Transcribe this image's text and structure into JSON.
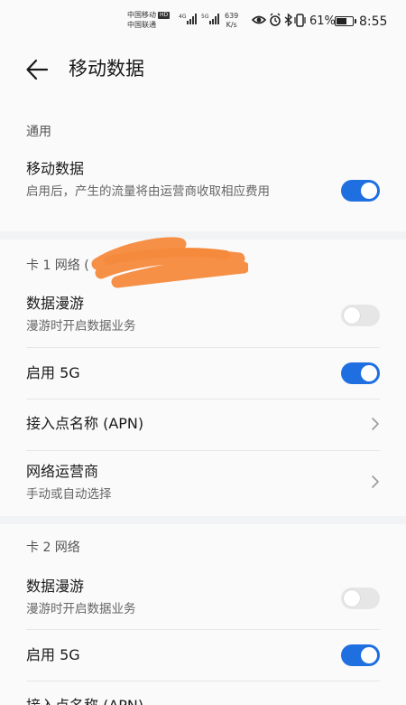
{
  "status_bar": {
    "carrier1": "中国移动",
    "hd": "HD",
    "carrier2": "中国联通",
    "net1": "4G",
    "net2": "5G",
    "speed_value": "639",
    "speed_unit": "K/s",
    "battery": "61%",
    "time": "8:55"
  },
  "header": {
    "title": "移动数据"
  },
  "general": {
    "heading": "通用",
    "mobile_data": {
      "title": "移动数据",
      "subtitle": "启用后，产生的流量将由运营商收取相应费用",
      "enabled": true
    }
  },
  "sim1": {
    "heading": "卡 1 网络 (",
    "roaming": {
      "title": "数据漫游",
      "subtitle": "漫游时开启数据业务",
      "enabled": false
    },
    "enable_5g": {
      "title": "启用 5G",
      "enabled": true
    },
    "apn": {
      "title": "接入点名称 (APN)"
    },
    "operator": {
      "title": "网络运营商",
      "subtitle": "手动或自动选择"
    }
  },
  "sim2": {
    "heading": "卡 2 网络",
    "roaming": {
      "title": "数据漫游",
      "subtitle": "漫游时开启数据业务",
      "enabled": false
    },
    "enable_5g": {
      "title": "启用 5G",
      "enabled": true
    },
    "apn": {
      "title": "接入点名称 (APN)"
    }
  },
  "colors": {
    "accent": "#1f6fe0",
    "background": "#fafafa",
    "section_gap": "#f1f3f5",
    "redaction": "#f58a3c"
  }
}
